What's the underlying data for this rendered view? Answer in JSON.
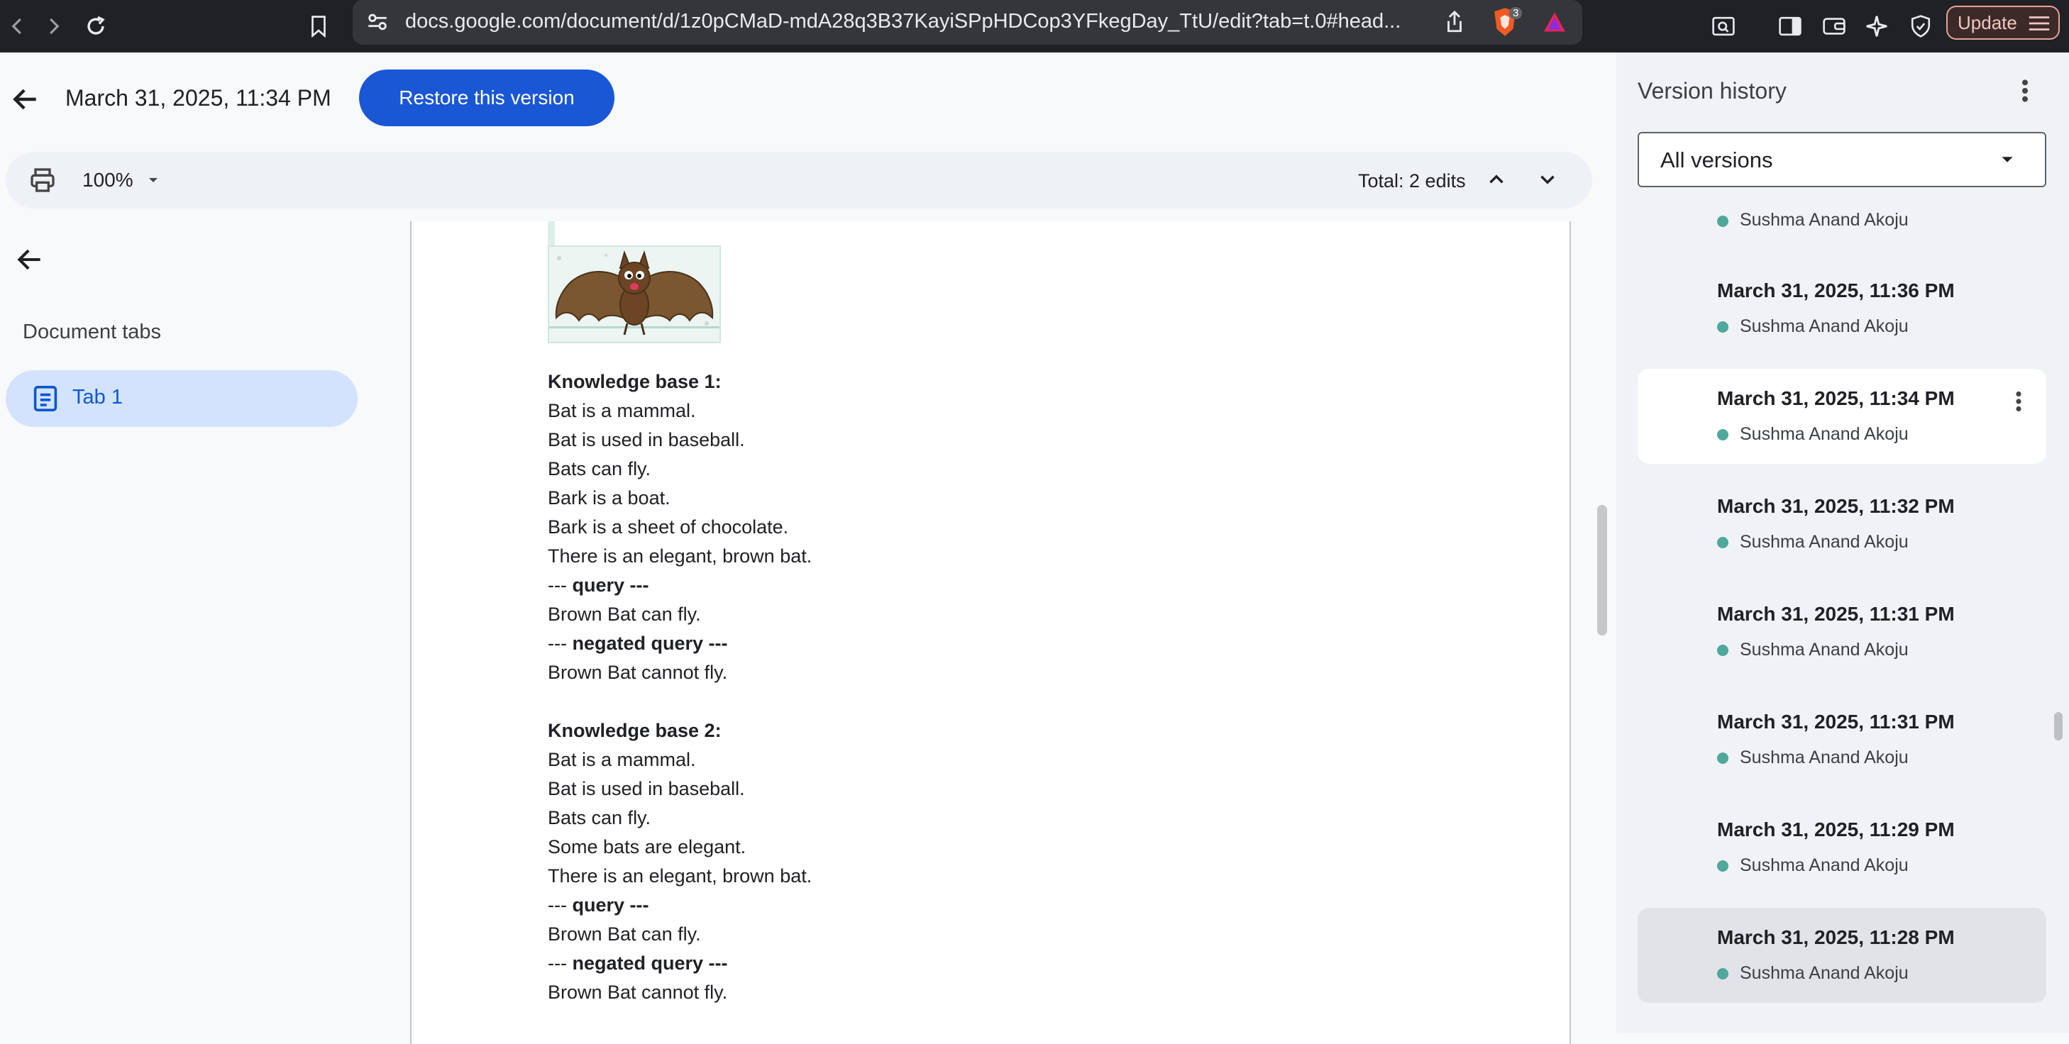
{
  "browser": {
    "url": "docs.google.com/document/d/1z0pCMaD-mdA28q3B37KayiSPpHDCop3YFkegDay_TtU/edit?tab=t.0#head...",
    "extension_badge": "3",
    "update_label": "Update"
  },
  "header": {
    "version_title": "March 31, 2025, 11:34 PM",
    "restore_label": "Restore this version"
  },
  "toolbar": {
    "zoom": "100%",
    "total_edits": "Total: 2 edits"
  },
  "sidebar": {
    "section_label": "Document tabs",
    "tabs": [
      {
        "label": "Tab 1"
      }
    ]
  },
  "document": {
    "lines": [
      {
        "text": "Knowledge base 1:",
        "bold": true
      },
      {
        "text": "Bat is a mammal."
      },
      {
        "text": "Bat is used in baseball."
      },
      {
        "text": "Bats can fly."
      },
      {
        "text": "Bark is a boat."
      },
      {
        "text": "Bark is a sheet of chocolate."
      },
      {
        "text": "There is an elegant, brown bat."
      },
      {
        "text": "--- query ---",
        "mixed": true
      },
      {
        "text": "Brown Bat can fly."
      },
      {
        "text": "--- negated query ---",
        "mixed": true
      },
      {
        "text": "Brown Bat cannot fly."
      },
      {
        "text": "",
        "blank": true
      },
      {
        "text": "Knowledge base 2:",
        "bold": true
      },
      {
        "text": "Bat is a mammal."
      },
      {
        "text": "Bat is used in baseball."
      },
      {
        "text": "Bats can fly."
      },
      {
        "text": "Some bats are elegant."
      },
      {
        "text": "There is an elegant, brown bat."
      },
      {
        "text": "--- query ---",
        "mixed": true
      },
      {
        "text": "Brown Bat can fly."
      },
      {
        "text": "--- negated query ---",
        "mixed": true
      },
      {
        "text": "Brown Bat cannot fly."
      }
    ]
  },
  "version_history": {
    "title": "Version history",
    "filter": "All versions",
    "top_author": "Sushma Anand Akoju",
    "items": [
      {
        "date": "March 31, 2025, 11:36 PM",
        "author": "Sushma Anand Akoju",
        "state": "normal"
      },
      {
        "date": "March 31, 2025, 11:34 PM",
        "author": "Sushma Anand Akoju",
        "state": "selected"
      },
      {
        "date": "March 31, 2025, 11:32 PM",
        "author": "Sushma Anand Akoju",
        "state": "normal"
      },
      {
        "date": "March 31, 2025, 11:31 PM",
        "author": "Sushma Anand Akoju",
        "state": "normal"
      },
      {
        "date": "March 31, 2025, 11:31 PM",
        "author": "Sushma Anand Akoju",
        "state": "normal"
      },
      {
        "date": "March 31, 2025, 11:29 PM",
        "author": "Sushma Anand Akoju",
        "state": "normal"
      },
      {
        "date": "March 31, 2025, 11:28 PM",
        "author": "Sushma Anand Akoju",
        "state": "hovered"
      }
    ],
    "author_dot_color": "#4fa89b"
  },
  "colors": {
    "accent": "#1a57d5",
    "tab_active_bg": "#d3e3fd",
    "tab_active_text": "#0b57d0"
  }
}
